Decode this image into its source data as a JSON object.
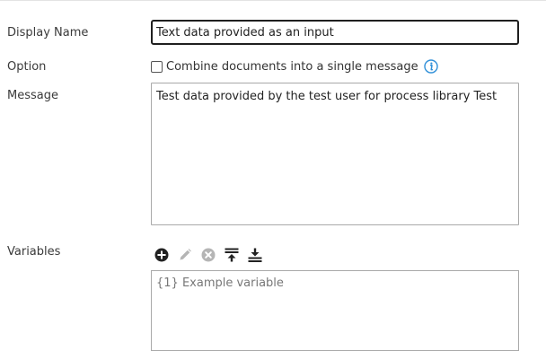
{
  "fields": {
    "display_name": {
      "label": "Display Name",
      "value": "Text data provided as an input"
    },
    "option": {
      "label": "Option",
      "checkbox_label": "Combine documents into a single message",
      "checked": false
    },
    "message": {
      "label": "Message",
      "value": "Test data provided by the test user for process library Test"
    },
    "variables": {
      "label": "Variables",
      "items": [
        "{1} Example variable"
      ]
    }
  },
  "toolbar": {
    "add_icon": "plus-circle-icon",
    "edit_icon": "pencil-icon",
    "remove_icon": "x-circle-icon",
    "move_top_icon": "arrow-to-top-icon",
    "move_bottom_icon": "arrow-to-bottom-icon"
  },
  "colors": {
    "label": "#3a3a3a",
    "info": "#2f8fd8",
    "active_icon": "#222222",
    "disabled_icon": "#b5b5b5"
  }
}
